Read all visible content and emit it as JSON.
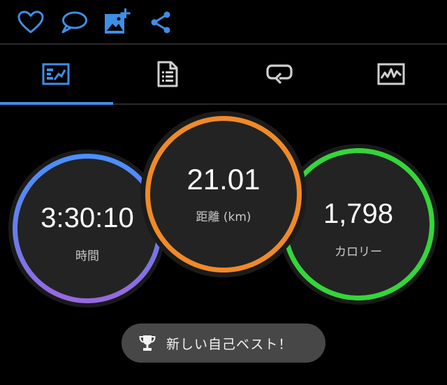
{
  "action_bar": {
    "icons": [
      "heart-icon",
      "comment-icon",
      "add-photo-icon",
      "share-icon"
    ],
    "accent_color": "#3f8ee6"
  },
  "tabs": {
    "selected_index": 0,
    "items": [
      "stats-summary-icon",
      "details-list-icon",
      "laps-icon",
      "charts-icon"
    ]
  },
  "metrics": {
    "time": {
      "value": "3:30:10",
      "label": "時間",
      "ring_color": "#4a90ff"
    },
    "distance": {
      "value": "21.01",
      "label": "距離 (km)",
      "ring_color": "#f08a28"
    },
    "calories": {
      "value": "1,798",
      "label": "カロリー",
      "ring_color": "#34d63a"
    }
  },
  "badge": {
    "icon": "trophy-icon",
    "text": "新しい自己ベスト！"
  }
}
